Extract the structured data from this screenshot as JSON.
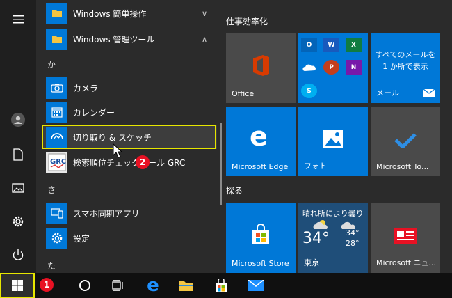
{
  "apps": {
    "simple_ops": "Windows 簡単操作",
    "admin_tools": "Windows 管理ツール",
    "header_ka": "か",
    "camera": "カメラ",
    "calendar": "カレンダー",
    "snip": "切り取り & スケッチ",
    "grc": "検索順位チェックツール GRC",
    "header_sa": "さ",
    "phone": "スマホ同期アプリ",
    "settings": "設定",
    "header_ta": "た"
  },
  "groups": {
    "productivity": "仕事効率化",
    "explore": "探る"
  },
  "tiles": {
    "office": "Office",
    "mail_text": "すべてのメールを 1 か所で表示",
    "mail": "メール",
    "edge": "Microsoft Edge",
    "photos": "フォト",
    "todo": "Microsoft To...",
    "store": "Microsoft Store",
    "weather_title": "晴れ所により曇り",
    "weather_temp": "34°",
    "weather_hi": "34°",
    "weather_lo": "28°",
    "weather_city": "東京",
    "news": "Microsoft ニュ..."
  },
  "badges": {
    "one": "1",
    "two": "2"
  },
  "colors": {
    "accent": "#0078d7",
    "highlight": "#e6e600",
    "badge": "#e81123"
  }
}
